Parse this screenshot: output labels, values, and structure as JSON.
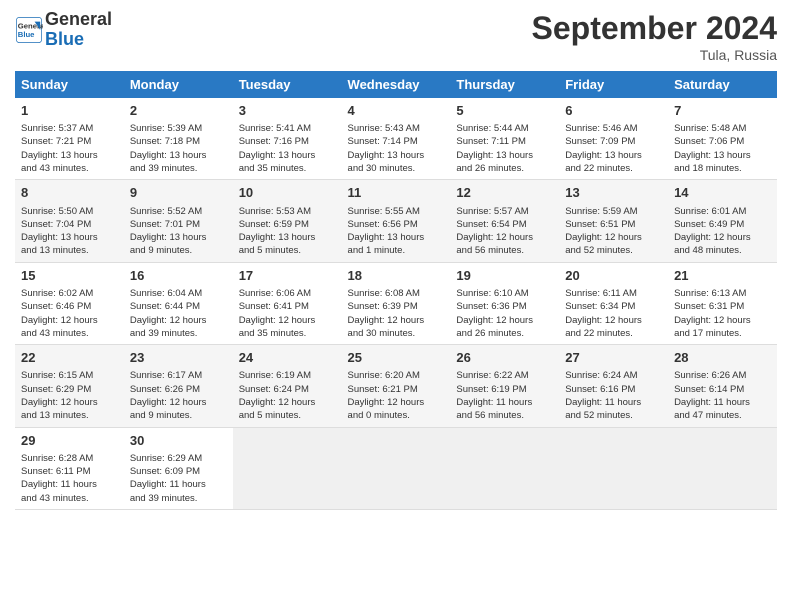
{
  "header": {
    "logo_line1": "General",
    "logo_line2": "Blue",
    "month": "September 2024",
    "location": "Tula, Russia"
  },
  "weekdays": [
    "Sunday",
    "Monday",
    "Tuesday",
    "Wednesday",
    "Thursday",
    "Friday",
    "Saturday"
  ],
  "weeks": [
    [
      {
        "day": "1",
        "lines": [
          "Sunrise: 5:37 AM",
          "Sunset: 7:21 PM",
          "Daylight: 13 hours",
          "and 43 minutes."
        ]
      },
      {
        "day": "2",
        "lines": [
          "Sunrise: 5:39 AM",
          "Sunset: 7:18 PM",
          "Daylight: 13 hours",
          "and 39 minutes."
        ]
      },
      {
        "day": "3",
        "lines": [
          "Sunrise: 5:41 AM",
          "Sunset: 7:16 PM",
          "Daylight: 13 hours",
          "and 35 minutes."
        ]
      },
      {
        "day": "4",
        "lines": [
          "Sunrise: 5:43 AM",
          "Sunset: 7:14 PM",
          "Daylight: 13 hours",
          "and 30 minutes."
        ]
      },
      {
        "day": "5",
        "lines": [
          "Sunrise: 5:44 AM",
          "Sunset: 7:11 PM",
          "Daylight: 13 hours",
          "and 26 minutes."
        ]
      },
      {
        "day": "6",
        "lines": [
          "Sunrise: 5:46 AM",
          "Sunset: 7:09 PM",
          "Daylight: 13 hours",
          "and 22 minutes."
        ]
      },
      {
        "day": "7",
        "lines": [
          "Sunrise: 5:48 AM",
          "Sunset: 7:06 PM",
          "Daylight: 13 hours",
          "and 18 minutes."
        ]
      }
    ],
    [
      {
        "day": "8",
        "lines": [
          "Sunrise: 5:50 AM",
          "Sunset: 7:04 PM",
          "Daylight: 13 hours",
          "and 13 minutes."
        ]
      },
      {
        "day": "9",
        "lines": [
          "Sunrise: 5:52 AM",
          "Sunset: 7:01 PM",
          "Daylight: 13 hours",
          "and 9 minutes."
        ]
      },
      {
        "day": "10",
        "lines": [
          "Sunrise: 5:53 AM",
          "Sunset: 6:59 PM",
          "Daylight: 13 hours",
          "and 5 minutes."
        ]
      },
      {
        "day": "11",
        "lines": [
          "Sunrise: 5:55 AM",
          "Sunset: 6:56 PM",
          "Daylight: 13 hours",
          "and 1 minute."
        ]
      },
      {
        "day": "12",
        "lines": [
          "Sunrise: 5:57 AM",
          "Sunset: 6:54 PM",
          "Daylight: 12 hours",
          "and 56 minutes."
        ]
      },
      {
        "day": "13",
        "lines": [
          "Sunrise: 5:59 AM",
          "Sunset: 6:51 PM",
          "Daylight: 12 hours",
          "and 52 minutes."
        ]
      },
      {
        "day": "14",
        "lines": [
          "Sunrise: 6:01 AM",
          "Sunset: 6:49 PM",
          "Daylight: 12 hours",
          "and 48 minutes."
        ]
      }
    ],
    [
      {
        "day": "15",
        "lines": [
          "Sunrise: 6:02 AM",
          "Sunset: 6:46 PM",
          "Daylight: 12 hours",
          "and 43 minutes."
        ]
      },
      {
        "day": "16",
        "lines": [
          "Sunrise: 6:04 AM",
          "Sunset: 6:44 PM",
          "Daylight: 12 hours",
          "and 39 minutes."
        ]
      },
      {
        "day": "17",
        "lines": [
          "Sunrise: 6:06 AM",
          "Sunset: 6:41 PM",
          "Daylight: 12 hours",
          "and 35 minutes."
        ]
      },
      {
        "day": "18",
        "lines": [
          "Sunrise: 6:08 AM",
          "Sunset: 6:39 PM",
          "Daylight: 12 hours",
          "and 30 minutes."
        ]
      },
      {
        "day": "19",
        "lines": [
          "Sunrise: 6:10 AM",
          "Sunset: 6:36 PM",
          "Daylight: 12 hours",
          "and 26 minutes."
        ]
      },
      {
        "day": "20",
        "lines": [
          "Sunrise: 6:11 AM",
          "Sunset: 6:34 PM",
          "Daylight: 12 hours",
          "and 22 minutes."
        ]
      },
      {
        "day": "21",
        "lines": [
          "Sunrise: 6:13 AM",
          "Sunset: 6:31 PM",
          "Daylight: 12 hours",
          "and 17 minutes."
        ]
      }
    ],
    [
      {
        "day": "22",
        "lines": [
          "Sunrise: 6:15 AM",
          "Sunset: 6:29 PM",
          "Daylight: 12 hours",
          "and 13 minutes."
        ]
      },
      {
        "day": "23",
        "lines": [
          "Sunrise: 6:17 AM",
          "Sunset: 6:26 PM",
          "Daylight: 12 hours",
          "and 9 minutes."
        ]
      },
      {
        "day": "24",
        "lines": [
          "Sunrise: 6:19 AM",
          "Sunset: 6:24 PM",
          "Daylight: 12 hours",
          "and 5 minutes."
        ]
      },
      {
        "day": "25",
        "lines": [
          "Sunrise: 6:20 AM",
          "Sunset: 6:21 PM",
          "Daylight: 12 hours",
          "and 0 minutes."
        ]
      },
      {
        "day": "26",
        "lines": [
          "Sunrise: 6:22 AM",
          "Sunset: 6:19 PM",
          "Daylight: 11 hours",
          "and 56 minutes."
        ]
      },
      {
        "day": "27",
        "lines": [
          "Sunrise: 6:24 AM",
          "Sunset: 6:16 PM",
          "Daylight: 11 hours",
          "and 52 minutes."
        ]
      },
      {
        "day": "28",
        "lines": [
          "Sunrise: 6:26 AM",
          "Sunset: 6:14 PM",
          "Daylight: 11 hours",
          "and 47 minutes."
        ]
      }
    ],
    [
      {
        "day": "29",
        "lines": [
          "Sunrise: 6:28 AM",
          "Sunset: 6:11 PM",
          "Daylight: 11 hours",
          "and 43 minutes."
        ]
      },
      {
        "day": "30",
        "lines": [
          "Sunrise: 6:29 AM",
          "Sunset: 6:09 PM",
          "Daylight: 11 hours",
          "and 39 minutes."
        ]
      },
      null,
      null,
      null,
      null,
      null
    ]
  ]
}
